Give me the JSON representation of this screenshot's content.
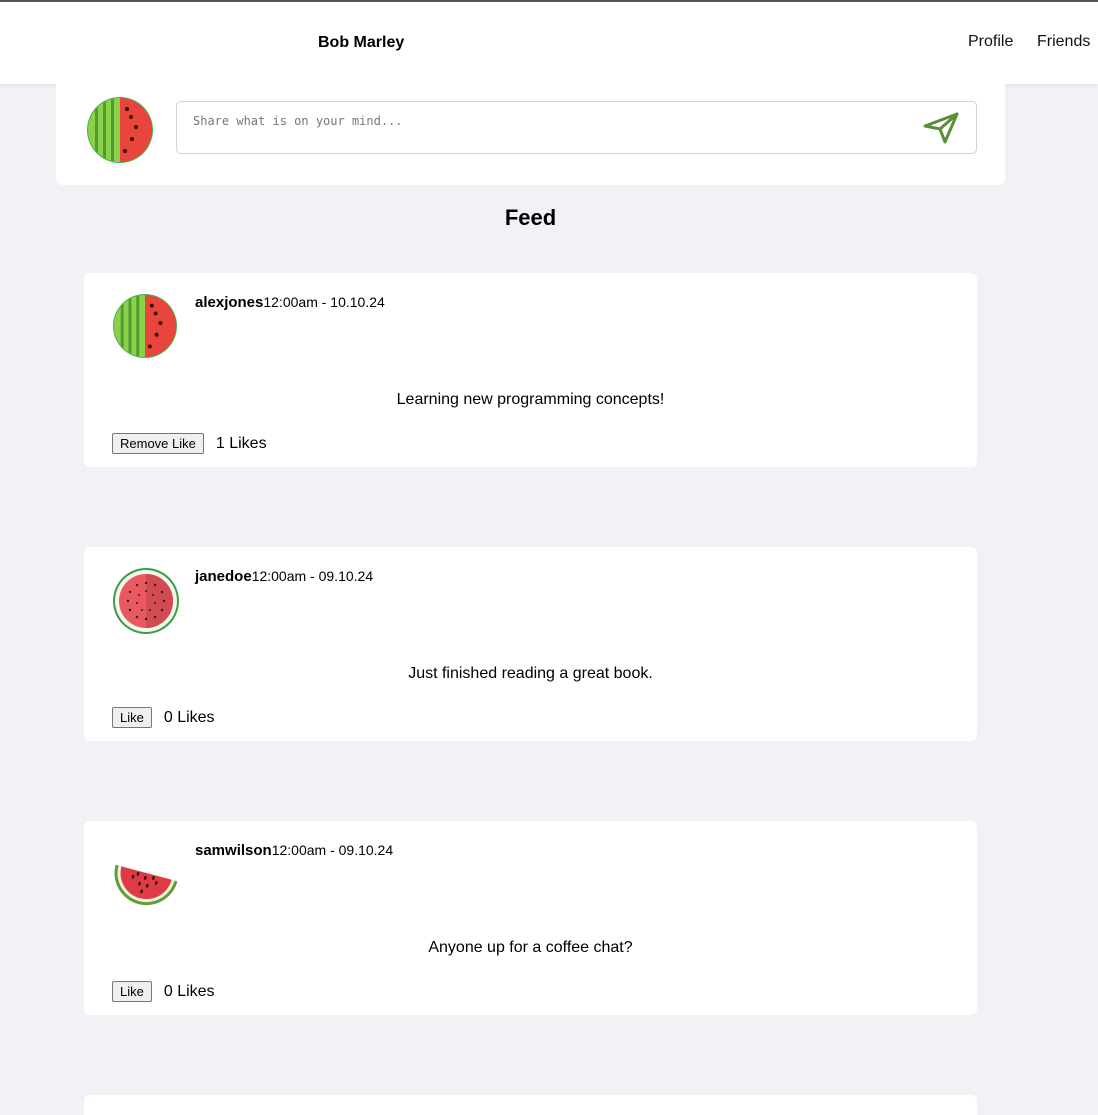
{
  "header": {
    "user_name": "Bob Marley",
    "nav": [
      {
        "label": "Profile"
      },
      {
        "label": "Friends"
      }
    ]
  },
  "composer": {
    "avatar_icon": "watermelon-half-icon",
    "placeholder": "Share what is on your mind...",
    "send_icon": "send-paper-plane-icon"
  },
  "feed": {
    "title": "Feed",
    "posts": [
      {
        "username": "alexjones",
        "time": "12:00am - 10.10.24",
        "content": "Learning new programming concepts!",
        "like_button": "Remove Like",
        "likes": "1 Likes",
        "avatar_icon": "watermelon-half-icon"
      },
      {
        "username": "janedoe",
        "time": "12:00am - 09.10.24",
        "content": "Just finished reading a great book.",
        "like_button": "Like",
        "likes": "0 Likes",
        "avatar_icon": "watermelon-round-icon"
      },
      {
        "username": "samwilson",
        "time": "12:00am - 09.10.24",
        "content": "Anyone up for a coffee chat?",
        "like_button": "Like",
        "likes": "0 Likes",
        "avatar_icon": "watermelon-slice-icon"
      }
    ]
  },
  "colors": {
    "background": "#f0f2f6",
    "card": "#ffffff",
    "melon_green": "#6abf40",
    "melon_red": "#e8453c",
    "send_icon": "#5a8e3a"
  }
}
